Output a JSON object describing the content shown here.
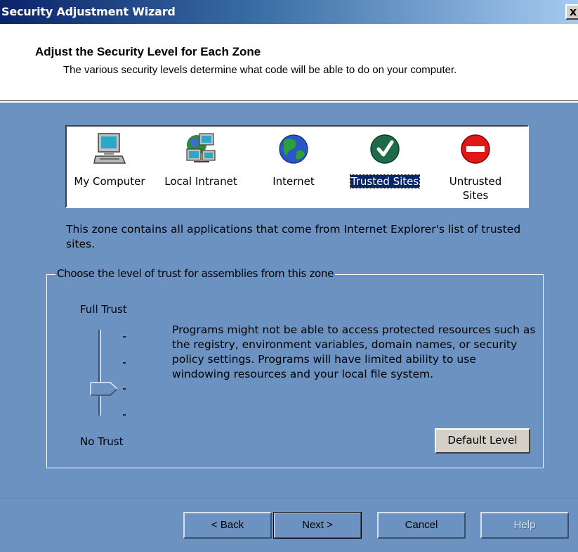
{
  "window": {
    "title": "Security Adjustment Wizard",
    "close_label": "x"
  },
  "header": {
    "heading": "Adjust the Security Level for Each Zone",
    "subtext": "The various security levels determine what code will be able to do on your computer."
  },
  "zones": [
    {
      "label": "My Computer",
      "icon": "computer-icon",
      "selected": false
    },
    {
      "label": "Local Intranet",
      "icon": "network-icon",
      "selected": false
    },
    {
      "label": "Internet",
      "icon": "globe-icon",
      "selected": false
    },
    {
      "label": "Trusted Sites",
      "icon": "checkmark-icon",
      "selected": true
    },
    {
      "label": "Untrusted Sites",
      "icon": "no-entry-icon",
      "selected": false
    }
  ],
  "zone_description": "This zone contains all applications that come from Internet Explorer's list of trusted sites.",
  "trust_group": {
    "legend": "Choose the level of trust for assemblies from this zone",
    "top_label": "Full Trust",
    "bottom_label": "No Trust",
    "level_fraction": 0.33,
    "level_description": "Programs might not be able to access protected resources such as the registry, environment variables, domain names, or security policy settings. Programs will have limited ability to use windowing resources and your local file system.",
    "default_button": "Default Level"
  },
  "footer": {
    "back": "< Back",
    "next": "Next >",
    "cancel": "Cancel",
    "help": "Help"
  },
  "colors": {
    "background": "#6b92c1",
    "selection": "#0a246a",
    "title_start": "#0a246a"
  }
}
